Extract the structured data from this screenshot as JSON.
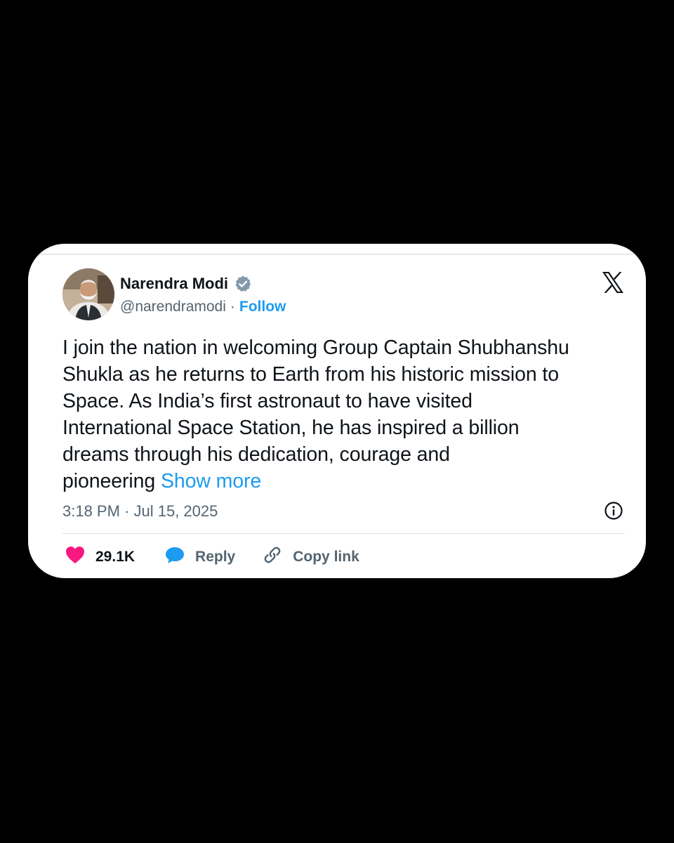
{
  "tweet": {
    "author_name": "Narendra Modi",
    "handle": "@narendramodi",
    "separator": "·",
    "follow_label": "Follow",
    "text_lines": [
      "I join the nation in welcoming Group Captain Shubhanshu",
      "Shukla as he returns to Earth from his historic mission to",
      "Space. As India’s first astronaut to have visited",
      "International Space Station, he has inspired a billion",
      "dreams through his dedication, courage and",
      "pioneering"
    ],
    "show_more_label": "Show more",
    "timestamp": "3:18 PM · Jul 15, 2025"
  },
  "actions": {
    "like_count": "29.1K",
    "reply_label": "Reply",
    "copy_link_label": "Copy link"
  },
  "icons": {
    "verified": "verified-badge-icon",
    "platform": "x-logo-icon",
    "info": "info-icon",
    "like": "heart-icon",
    "reply": "speech-bubble-icon",
    "copy": "link-icon"
  },
  "colors": {
    "page_background": "#000000",
    "card_background": "#ffffff",
    "accent_blue": "#1d9bf0",
    "heart": "#f91880",
    "text_primary": "#0f1419",
    "text_secondary": "#536471",
    "verified_gray": "#829aab"
  }
}
